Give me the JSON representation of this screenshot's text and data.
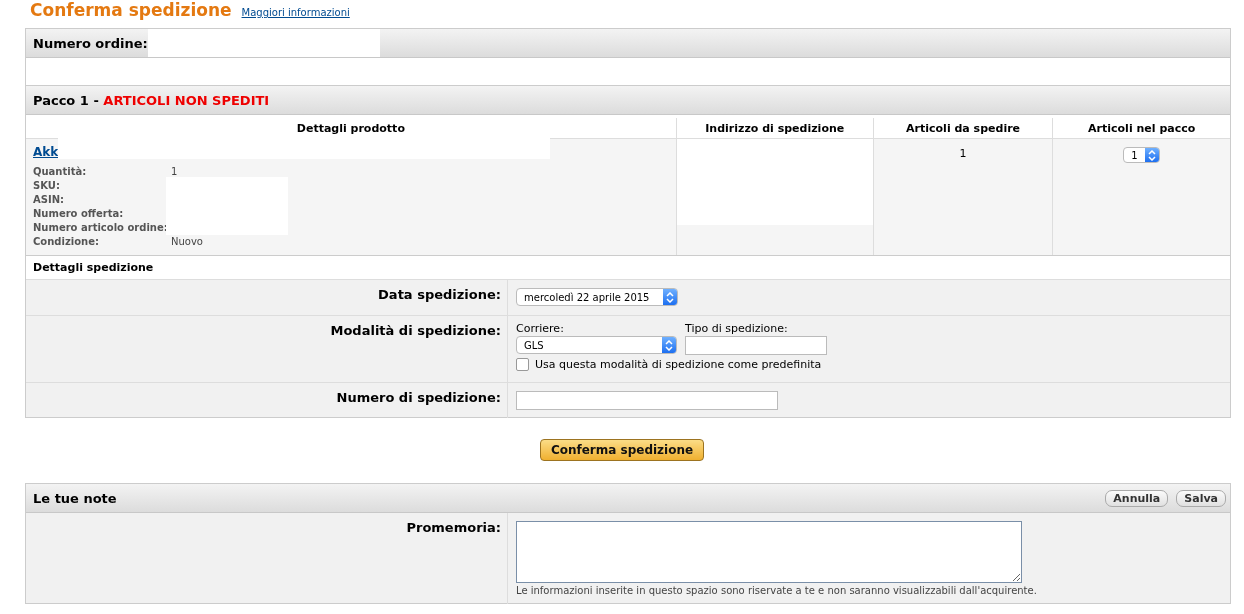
{
  "page": {
    "title": "Conferma spedizione",
    "help_link": "Maggiori informazioni"
  },
  "order": {
    "label": "Numero ordine:"
  },
  "package": {
    "title": "Pacco 1 - ",
    "status": "ARTICOLI NON SPEDITI"
  },
  "table": {
    "columns": [
      "Dettagli prodotto",
      "Indirizzo di spedizione",
      "Articoli da spedire",
      "Articoli nel pacco"
    ],
    "product": {
      "link": "Akk",
      "details": [
        {
          "label": "Quantità:",
          "value": "1"
        },
        {
          "label": "SKU:"
        },
        {
          "label": "ASIN:"
        },
        {
          "label": "Numero offerta:"
        },
        {
          "label": "Numero articolo ordine:"
        },
        {
          "label": "Condizione:",
          "value": "Nuovo"
        }
      ]
    },
    "to_ship": "1",
    "in_package": "1"
  },
  "shipping": {
    "title": "Dettagli spedizione",
    "date": {
      "label": "Data spedizione:",
      "value": "mercoledì 22 aprile 2015"
    },
    "method": {
      "label": "Modalità di spedizione:",
      "carrier_label": "Corriere:",
      "carrier": "GLS",
      "type_label": "Tipo di spedizione:",
      "default_checkbox": {
        "label": "Usa questa modalità di spedizione come predefinita",
        "checked": false
      }
    },
    "tracking": {
      "label": "Numero di spedizione:"
    }
  },
  "confirm_button": "Conferma spedizione",
  "notes": {
    "title": "Le tue note",
    "buttons": [
      "Annulla",
      "Salva"
    ],
    "label": "Promemoria:",
    "hint": "Le informazioni inserite in questo spazio sono riservate a te e non saranno visualizzabili dall'acquirente."
  }
}
